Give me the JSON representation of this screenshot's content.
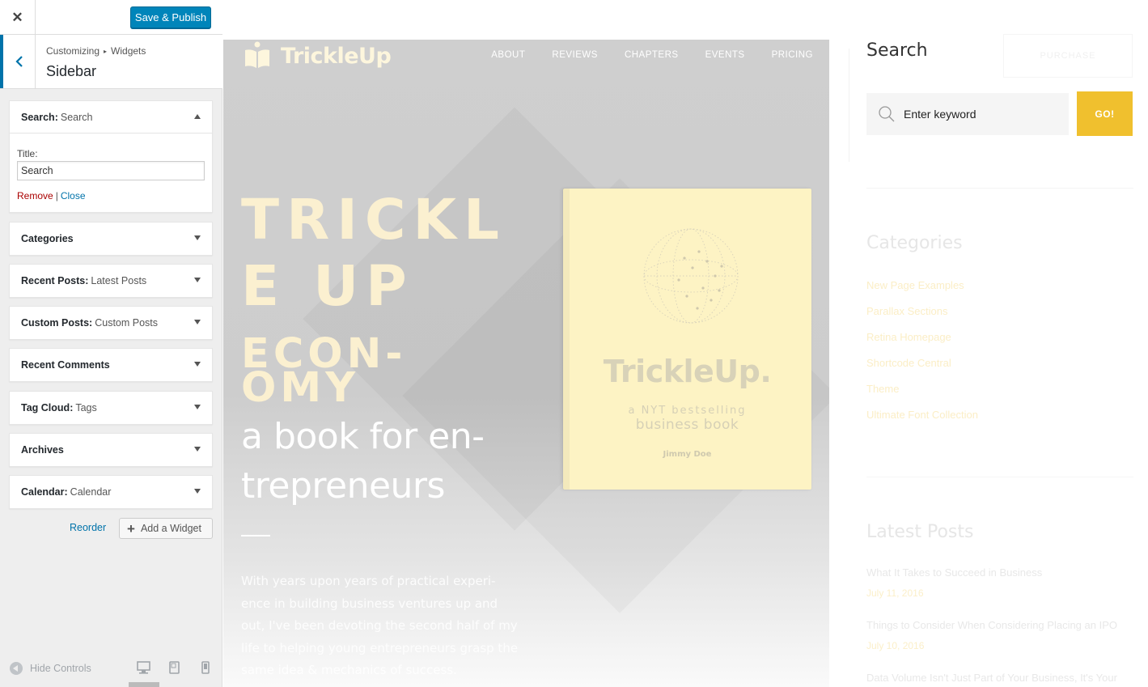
{
  "panel": {
    "close_symbol": "✕",
    "save_label": "Save & Publish",
    "breadcrumb": [
      "Customizing",
      "Widgets"
    ],
    "breadcrumb_sep": "▸",
    "section_title": "Sidebar"
  },
  "widgets": [
    {
      "name": "Search",
      "sub": "Search",
      "expanded": true
    },
    {
      "name": "Categories",
      "sub": ""
    },
    {
      "name": "Recent Posts",
      "sub": "Latest Posts"
    },
    {
      "name": "Custom Posts",
      "sub": "Custom Posts"
    },
    {
      "name": "Recent Comments",
      "sub": ""
    },
    {
      "name": "Tag Cloud",
      "sub": "Tags"
    },
    {
      "name": "Archives",
      "sub": ""
    },
    {
      "name": "Calendar",
      "sub": "Calendar"
    }
  ],
  "search_widget": {
    "title_label": "Title:",
    "title_value": "Search",
    "remove_label": "Remove",
    "separator": "|",
    "close_label": "Close"
  },
  "actions": {
    "reorder_label": "Reorder",
    "add_widget_label": "Add a Widget"
  },
  "footer": {
    "hide_controls_label": "Hide Controls",
    "devices": [
      "desktop",
      "tablet",
      "mobile"
    ],
    "active_device": "desktop"
  },
  "preview": {
    "logo_text": "TrickleUp",
    "nav": [
      "ABOUT",
      "REVIEWS",
      "CHAPTERS",
      "EVENTS",
      "PRICING"
    ],
    "hero_title_line1": "TRICKL",
    "hero_title_line2": "E UP",
    "hero_title2_line1": "ECON-",
    "hero_title2_line2": "OMY",
    "hero_sub_line1": "a book for en-",
    "hero_sub_line2": "trepreneurs",
    "hero_body": "With years upon years of practical experi- ence in building business ventures up and out, I've been devoting the second half of my life to helping young entrepreneurs grasp the same idea & mechanics of success.",
    "book": {
      "title": "TrickleUp.",
      "line1": "a NYT bestselling",
      "line2": "business book",
      "author": "Jimmy Doe"
    },
    "sidebar": {
      "search_title": "Search",
      "purchase_label": "PURCHASE",
      "search_placeholder": "Enter keyword",
      "go_label": "GO!",
      "categories_title": "Categories",
      "categories": [
        "New Page Examples",
        "Parallax Sections",
        "Retina Homepage",
        "Shortcode Central",
        "Theme",
        "Ultimate Font Collection"
      ],
      "latest_posts_title": "Latest Posts",
      "posts": [
        {
          "title": "What It Takes to Succeed in Business",
          "date": "July 11, 2016"
        },
        {
          "title": "Things to Consider When Considering Placing an IPO",
          "date": "July 10, 2016"
        },
        {
          "title": "Data Volume Isn't Just Part of Your Business, It's Your",
          "date": ""
        }
      ]
    }
  },
  "colors": {
    "wp_blue": "#0073aa",
    "publish_blue": "#0085ba",
    "remove_red": "#aa0000",
    "go_yellow": "#f0c02e",
    "book_cream": "#fdf3c4"
  }
}
